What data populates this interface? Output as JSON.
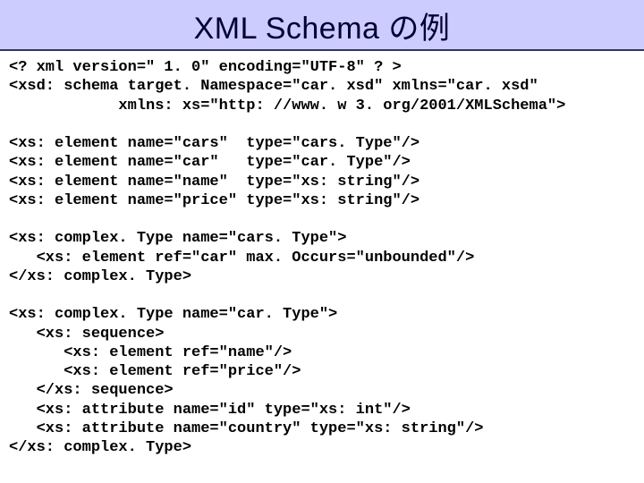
{
  "title": "XML Schema の例",
  "code": {
    "l01": "<? xml version=\" 1. 0\" encoding=\"UTF-8\" ? >",
    "l02": "<xsd: schema target. Namespace=\"car. xsd\" xmlns=\"car. xsd\"",
    "l03": "            xmlns: xs=\"http: //www. w 3. org/2001/XMLSchema\">",
    "l04": "",
    "l05": "<xs: element name=\"cars\"  type=\"cars. Type\"/>",
    "l06": "<xs: element name=\"car\"   type=\"car. Type\"/>",
    "l07": "<xs: element name=\"name\"  type=\"xs: string\"/>",
    "l08": "<xs: element name=\"price\" type=\"xs: string\"/>",
    "l09": "",
    "l10": "<xs: complex. Type name=\"cars. Type\">",
    "l11": "   <xs: element ref=\"car\" max. Occurs=\"unbounded\"/>",
    "l12": "</xs: complex. Type>",
    "l13": "",
    "l14": "<xs: complex. Type name=\"car. Type\">",
    "l15": "   <xs: sequence>",
    "l16": "      <xs: element ref=\"name\"/>",
    "l17": "      <xs: element ref=\"price\"/>",
    "l18": "   </xs: sequence>",
    "l19": "   <xs: attribute name=\"id\" type=\"xs: int\"/>",
    "l20": "   <xs: attribute name=\"country\" type=\"xs: string\"/>",
    "l21": "</xs: complex. Type>"
  }
}
